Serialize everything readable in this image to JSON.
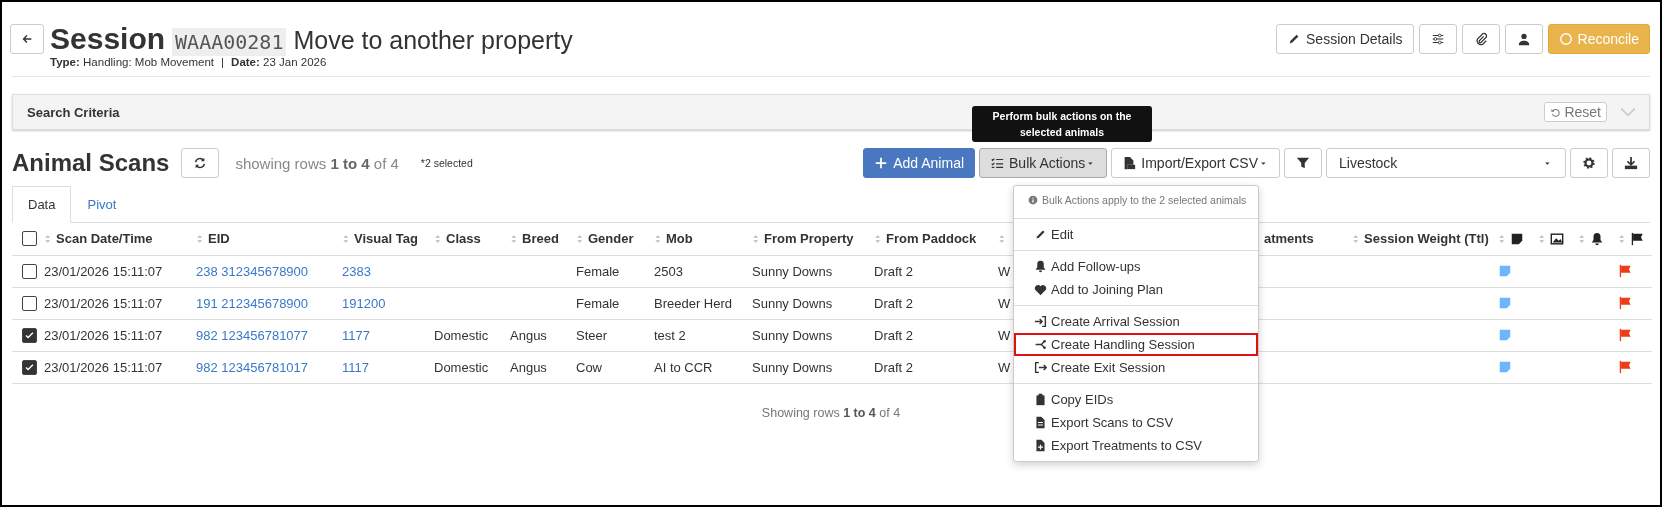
{
  "header": {
    "title": "Session",
    "session_id": "WAAA00281",
    "name": "Move to another property",
    "meta_separator": "|",
    "meta": [
      {
        "label": "Type:",
        "value": "Handling: Mob Movement"
      },
      {
        "label": "Date:",
        "value": "23 Jan 2026"
      }
    ],
    "buttons": [
      {
        "kind": "text",
        "label": "Session Details"
      },
      {
        "kind": "sliders"
      },
      {
        "kind": "clip"
      },
      {
        "kind": "user"
      },
      {
        "kind": "primary",
        "label": "Reconcile"
      }
    ]
  },
  "search_criteria": {
    "title": "Search Criteria",
    "reset": "Reset",
    "expanded": false
  },
  "scans": {
    "title": "Animal Scans",
    "showing": "showing rows **1 to 4** of 4",
    "selected_note": "*2 selected",
    "toolbar": [
      {
        "kind": "add",
        "label": "Add Animal"
      },
      {
        "kind": "bulk",
        "label": "Bulk Actions",
        "active": true
      },
      {
        "kind": "csv",
        "label": "Import/Export CSV"
      },
      {
        "kind": "filter"
      },
      {
        "kind": "select",
        "label": "Livestock"
      },
      {
        "kind": "gear"
      },
      {
        "kind": "download"
      }
    ],
    "tooltip": "Perform bulk actions on the selected animals"
  },
  "tabs": [
    {
      "label": "Data",
      "selected": true
    },
    {
      "label": "Pivot",
      "selected": false
    }
  ],
  "table": {
    "all_selected": false,
    "columns": [
      {
        "kind": "text",
        "label": "Scan Date/Time",
        "sort_icon": true
      },
      {
        "kind": "link",
        "label": "EID",
        "sort_icon": true
      },
      {
        "kind": "link",
        "label": "Visual Tag",
        "sort_icon": true
      },
      {
        "kind": "text",
        "label": "Class",
        "sort_icon": true
      },
      {
        "kind": "text",
        "label": "Breed",
        "sort_icon": true
      },
      {
        "kind": "text",
        "label": "Gender",
        "sort_icon": true
      },
      {
        "kind": "text",
        "label": "Mob",
        "sort_icon": true
      },
      {
        "kind": "text",
        "label": "From Property",
        "sort_icon": true
      },
      {
        "kind": "text",
        "label": "From Paddock",
        "sort_icon": true
      },
      {
        "kind": "text",
        "sort_icon": true
      },
      {
        "kind": "text",
        "label": "atments",
        "sort_icon": false
      },
      {
        "kind": "text",
        "label": "Session Weight (Ttl)",
        "sort_icon": true
      },
      {
        "kind": "note",
        "sort_icon": true
      },
      {
        "kind": "image",
        "sort_icon": true
      },
      {
        "kind": "bell",
        "sort_icon": true
      },
      {
        "kind": "flag",
        "sort_icon": true
      }
    ],
    "rows": [
      {
        "selected": false,
        "note": true,
        "flag": true,
        "cells": [
          "23/01/2026 15:11:07",
          "238 312345678900",
          "2383",
          null,
          null,
          "Female",
          "2503",
          "Sunny Downs",
          "Draft 2",
          "W",
          null,
          null
        ]
      },
      {
        "selected": false,
        "note": true,
        "flag": true,
        "cells": [
          "23/01/2026 15:11:07",
          "191 212345678900",
          "191200",
          null,
          null,
          "Female",
          "Breeder Herd",
          "Sunny Downs",
          "Draft 2",
          "W",
          null,
          null
        ]
      },
      {
        "selected": true,
        "note": true,
        "flag": true,
        "cells": [
          "23/01/2026 15:11:07",
          "982 123456781077",
          "1177",
          "Domestic",
          "Angus",
          "Steer",
          "test 2",
          "Sunny Downs",
          "Draft 2",
          "W",
          null,
          null
        ]
      },
      {
        "selected": true,
        "note": true,
        "flag": true,
        "cells": [
          "23/01/2026 15:11:07",
          "982 123456781017",
          "1117",
          "Domestic",
          "Angus",
          "Cow",
          "AI to CCR",
          "Sunny Downs",
          "Draft 2",
          "W",
          null,
          null
        ]
      }
    ],
    "footer": "Showing rows **1 to 4** of 4"
  },
  "bulk_menu": [
    {
      "kind": "info",
      "label": "Bulk Actions apply to the 2 selected animals"
    },
    {
      "kind": "divider"
    },
    {
      "kind": "item",
      "label": "Edit",
      "highlighted": false
    },
    {
      "kind": "divider"
    },
    {
      "kind": "item",
      "label": "Add Follow-ups",
      "highlighted": false
    },
    {
      "kind": "item",
      "label": "Add to Joining Plan",
      "highlighted": false
    },
    {
      "kind": "divider"
    },
    {
      "kind": "item",
      "label": "Create Arrival Session",
      "highlighted": false
    },
    {
      "kind": "item",
      "label": "Create Handling Session",
      "highlighted": true
    },
    {
      "kind": "item",
      "label": "Create Exit Session",
      "highlighted": false
    },
    {
      "kind": "divider"
    },
    {
      "kind": "item",
      "label": "Copy EIDs",
      "highlighted": false
    },
    {
      "kind": "item",
      "label": "Export Scans to CSV",
      "highlighted": false
    },
    {
      "kind": "item",
      "label": "Export Treatments to CSV",
      "highlighted": false
    }
  ]
}
